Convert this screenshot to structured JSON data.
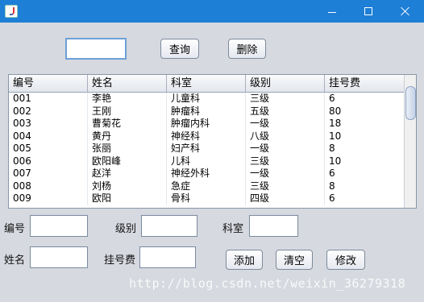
{
  "window": {
    "buttons": [
      "minimize",
      "maximize",
      "close"
    ]
  },
  "search": {
    "value": "",
    "query_label": "查询",
    "delete_label": "删除"
  },
  "table": {
    "columns": [
      "编号",
      "姓名",
      "科室",
      "级别",
      "挂号费"
    ],
    "rows": [
      [
        "001",
        "李艳",
        "儿童科",
        "三级",
        "6"
      ],
      [
        "002",
        "王刚",
        "肿瘤科",
        "五级",
        "80"
      ],
      [
        "003",
        "曹菊花",
        "肿瘤内科",
        "一级",
        "18"
      ],
      [
        "004",
        "黄丹",
        "神经科",
        "八级",
        "10"
      ],
      [
        "005",
        "张丽",
        "妇产科",
        "一级",
        "8"
      ],
      [
        "006",
        "欧阳峰",
        "儿科",
        "三级",
        "10"
      ],
      [
        "007",
        "赵洋",
        "神经外科",
        "一级",
        "6"
      ],
      [
        "008",
        "刘杨",
        "急症",
        "三级",
        "8"
      ],
      [
        "009",
        "欧阳",
        "骨科",
        "四级",
        "6"
      ]
    ]
  },
  "form": {
    "id_label": "编号",
    "level_label": "级别",
    "dept_label": "科室",
    "name_label": "姓名",
    "fee_label": "挂号费",
    "add_label": "添加",
    "clear_label": "清空",
    "edit_label": "修改"
  },
  "watermark": "http://blog.csdn.net/weixin_36279318",
  "colors": {
    "titlebar": "#1e7fd6",
    "background": "#d6d9df"
  }
}
